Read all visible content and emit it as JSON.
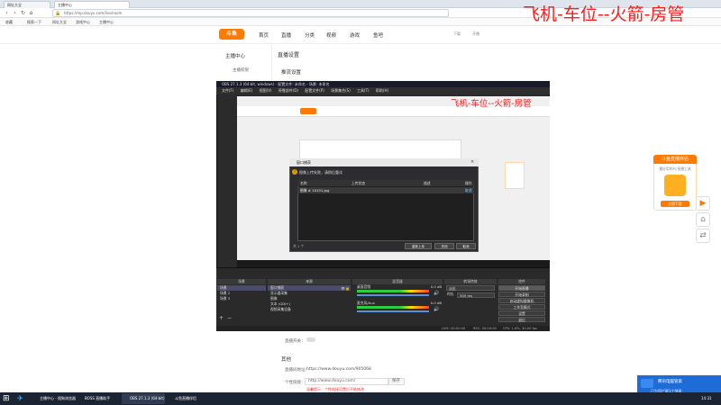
{
  "browser": {
    "tabs": [
      "网址大全",
      "主播中心"
    ],
    "url": "https://mp.douyu.com/live/room",
    "bookmarks": [
      "收藏",
      "搜索一下",
      "网址大全",
      "游戏中心",
      "主播中心"
    ]
  },
  "douyu": {
    "logo": "斗鱼",
    "nav": [
      "首页",
      "直播",
      "分类",
      "视频",
      "游戏",
      "鱼吧"
    ],
    "header_right": [
      "下载",
      "开播",
      "用户名称"
    ],
    "sidebar_title": "主播中心",
    "sidebar_item": "主播权限",
    "content_title": "直播设置",
    "content_sub": "推流设置",
    "other_title": "其他",
    "room_label": "直播间地址：",
    "room_url": "https://www.douyu.com/905068",
    "link_label": "个性链接：",
    "link_value": "http://www.douyu.com/",
    "link_button": "保存",
    "link_hint": "温馨提示：个性链接设置后不能修改",
    "toggle_label": "直播开关："
  },
  "overlay": {
    "text": "飞机-车位--火箭-房管"
  },
  "obs": {
    "title": "OBS 27.1.3 (64-bit, windows) - 配置文件: 未命名 - 场景: 未命名",
    "menu": [
      "文件(F)",
      "编辑(E)",
      "视图(V)",
      "停靠部件(D)",
      "配置文件(P)",
      "场景集合(S)",
      "工具(T)",
      "帮助(H)"
    ],
    "dialog": {
      "title": "窗口捕获",
      "message": "图像上传失败，请稍后重试",
      "headers": [
        "名称",
        "上传状态",
        "描述",
        "操作"
      ],
      "row": [
        "图像 # 10191.jpg",
        "",
        "",
        "取消"
      ],
      "footer": "共 1 个",
      "buttons": [
        "重新上传",
        "关闭",
        "取消"
      ]
    },
    "docks": {
      "scenes_title": "场景",
      "scenes": [
        "场景",
        "场景 2",
        "场景 3"
      ],
      "sources_title": "来源",
      "sources": [
        "窗口捕获",
        "显示器采集",
        "图像",
        "文本 (GDI+)",
        "视频采集设备"
      ],
      "mixer_title": "混音器",
      "mixer": [
        {
          "name": "桌面音频",
          "db": "0.0 dB"
        },
        {
          "name": "麦克风/Aux",
          "db": "0.0 dB"
        }
      ],
      "transitions_title": "转场特效",
      "transition": "淡出",
      "duration_label": "时长",
      "duration": "300 ms",
      "controls_title": "控件",
      "controls": [
        "开始直播",
        "开始录制",
        "启动虚拟摄像机",
        "工作室模式",
        "设置",
        "退出"
      ]
    },
    "status": {
      "live": "LIVE: 00:00:00",
      "rec": "REC: 00:00:00",
      "cpu": "CPU: 1.6%, 30.00 fps"
    }
  },
  "promo": {
    "title": "斗鱼直播伴侣",
    "text": "最好用的PC直播工具",
    "button": "立即下载"
  },
  "notify": {
    "title": "腾讯电脑管家",
    "text": "已为您拦截1个弹窗"
  },
  "taskbar": {
    "items": [
      "主播中心 - 搜狗浏览器",
      "BOSS 直播助手",
      "OBS 27.1.3 (64-bit)",
      "斗鱼直播伴侣"
    ],
    "time": "14:31"
  },
  "colors": {
    "accent": "#ff7a00",
    "overlay": "#ff1a1a"
  }
}
